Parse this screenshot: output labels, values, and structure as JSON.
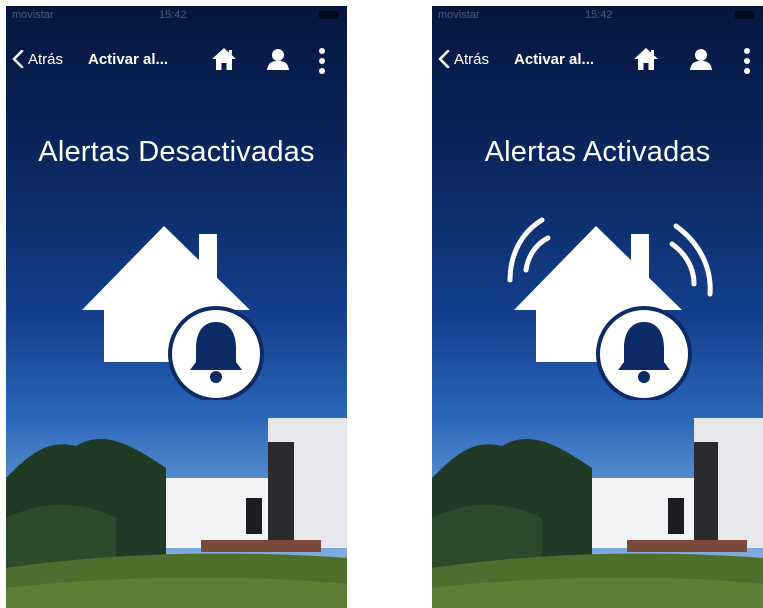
{
  "screens": [
    {
      "status": {
        "carrier": "movistar",
        "time": "15:42"
      },
      "nav": {
        "back_label": "Atrás",
        "title": "Activar al..."
      },
      "alert_title": "Alertas Desactivadas",
      "state": "off"
    },
    {
      "status": {
        "carrier": "movistar",
        "time": "15:42"
      },
      "nav": {
        "back_label": "Atrás",
        "title": "Activar al..."
      },
      "alert_title": "Alertas Activadas",
      "state": "on"
    }
  ],
  "icons": [
    "chevron-left-icon",
    "home-icon",
    "user-icon",
    "more-vertical-icon",
    "house-bell-icon",
    "alarm-waves-icon"
  ],
  "colors": {
    "sky_top": "#06163e",
    "sky_bottom": "#9cc0e6",
    "foreground": "#ffffff",
    "grass": "#4f6e2e"
  }
}
